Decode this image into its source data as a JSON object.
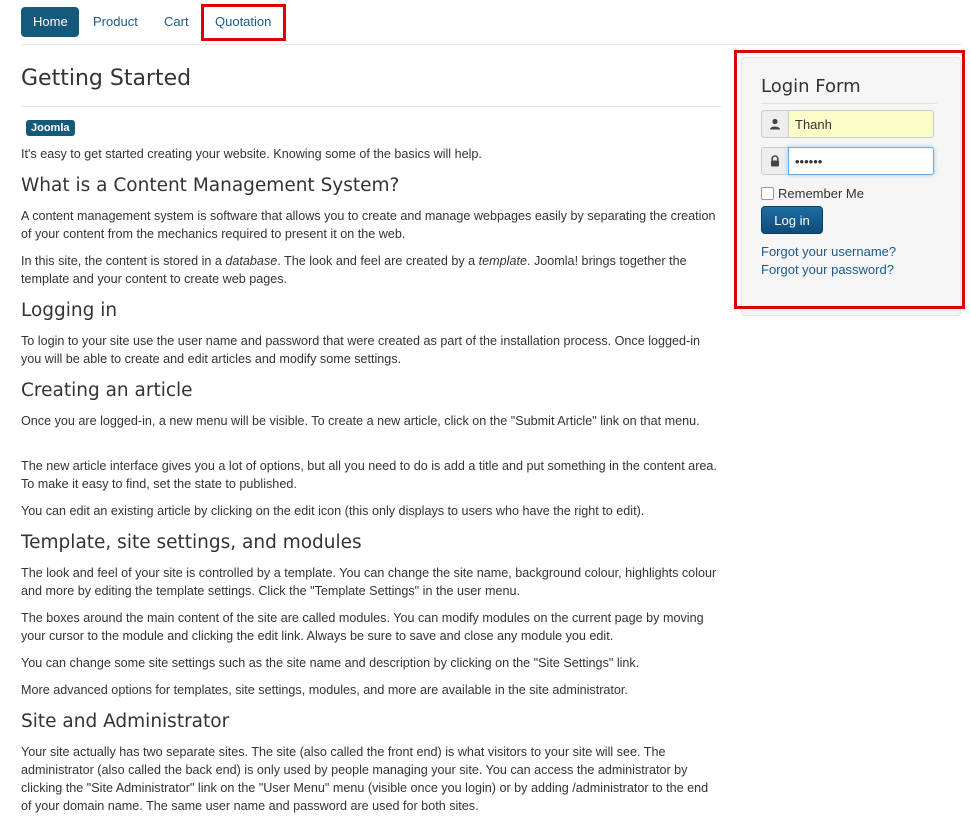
{
  "nav": {
    "items": [
      {
        "label": "Home",
        "active": true
      },
      {
        "label": "Product",
        "active": false
      },
      {
        "label": "Cart",
        "active": false
      },
      {
        "label": "Quotation",
        "active": false
      }
    ]
  },
  "article": {
    "title": "Getting Started",
    "tag": "Joomla",
    "intro": "It's easy to get started creating your website. Knowing some of the basics will help.",
    "sections": [
      {
        "heading": "What is a Content Management System?",
        "paragraphs": [
          "A content management system is software that allows you to create and manage webpages easily by separating the creation of your content from the mechanics required to present it on the web."
        ],
        "cms_p2": {
          "before": "In this site, the content is stored in a ",
          "em1": "database",
          "middle": ". The look and feel are created by a ",
          "em2": "template",
          "after": ". Joomla! brings together the template and your content to create web pages."
        }
      },
      {
        "heading": "Logging in",
        "paragraphs": [
          "To login to your site use the user name and password that were created as part of the installation process. Once logged-in you will be able to create and edit articles and modify some settings."
        ]
      },
      {
        "heading": "Creating an article",
        "paragraphs": [
          "Once you are logged-in, a new menu will be visible. To create a new article, click on the \"Submit Article\" link on that menu.",
          "The new article interface gives you a lot of options, but all you need to do is add a title and put something in the content area. To make it easy to find, set the state to published.",
          "You can edit an existing article by clicking on the edit icon (this only displays to users who have the right to edit)."
        ]
      },
      {
        "heading": "Template, site settings, and modules",
        "paragraphs": [
          "The look and feel of your site is controlled by a template. You can change the site name, background colour, highlights colour and more by editing the template settings. Click the \"Template Settings\" in the user menu.",
          "The boxes around the main content of the site are called modules. You can modify modules on the current page by moving your cursor to the module and clicking the edit link. Always be sure to save and close any module you edit.",
          "You can change some site settings such as the site name and description by clicking on the \"Site Settings\" link.",
          "More advanced options for templates, site settings, modules, and more are available in the site administrator."
        ]
      },
      {
        "heading": "Site and Administrator",
        "paragraphs": [
          "Your site actually has two separate sites. The site (also called the front end) is what visitors to your site will see. The administrator (also called the back end) is only used by people managing your site. You can access the administrator by clicking the \"Site Administrator\" link on the \"User Menu\" menu (visible once you login) or by adding /administrator to the end of your domain name. The same user name and password are used for both sites."
        ]
      }
    ]
  },
  "login": {
    "title": "Login Form",
    "username_value": "Thanh",
    "password_value": "••••••",
    "remember_label": "Remember Me",
    "submit_label": "Log in",
    "forgot_username": "Forgot your username?",
    "forgot_password": "Forgot your password?"
  },
  "colors": {
    "brand": "#15597d",
    "link": "#1b5a8c",
    "highlight": "#e00000"
  },
  "icons": {
    "username": "user-icon",
    "password": "lock-icon"
  }
}
